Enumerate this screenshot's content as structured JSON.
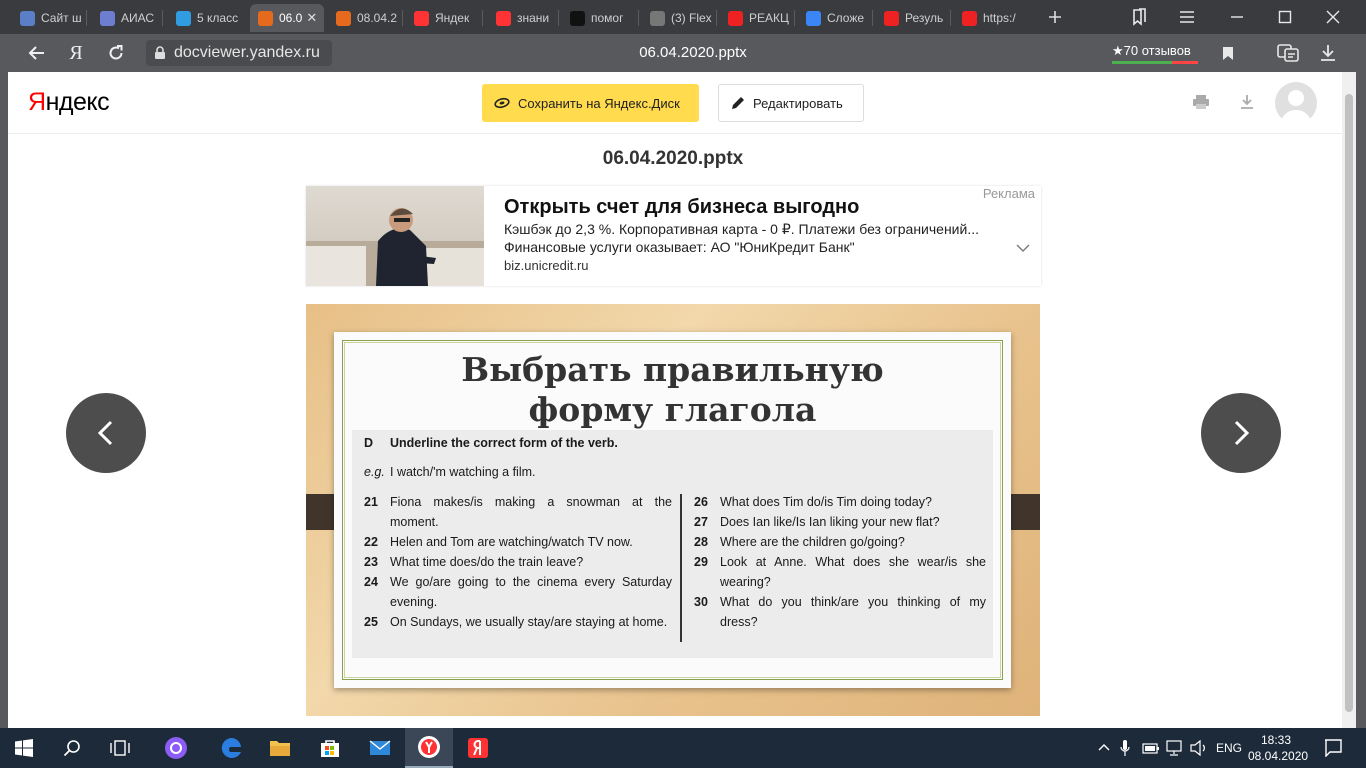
{
  "browser": {
    "tabs": [
      {
        "title": "Сайт ш",
        "icon": "site-icon",
        "color": "#5b7fc7"
      },
      {
        "title": "АИАС",
        "icon": "aias-icon",
        "color": "#6d7ed1"
      },
      {
        "title": "5 класс",
        "icon": "edu-icon",
        "color": "#2f9de0"
      },
      {
        "title": "06.0",
        "icon": "pptx-icon",
        "color": "#e56a1e",
        "active": true
      },
      {
        "title": "08.04.2",
        "icon": "pptx-icon",
        "color": "#e56a1e"
      },
      {
        "title": "Яндек",
        "icon": "yandex-icon",
        "color": "#f33"
      },
      {
        "title": "знани",
        "icon": "yandex-icon",
        "color": "#f33"
      },
      {
        "title": "помог",
        "icon": "znanija-icon",
        "color": "#111"
      },
      {
        "title": "(3) Flex",
        "icon": "flex-icon",
        "color": "#777"
      },
      {
        "title": "РЕАКЦ",
        "icon": "youtube-icon",
        "color": "#e22"
      },
      {
        "title": "Сложе",
        "icon": "doc-icon",
        "color": "#3b86f7"
      },
      {
        "title": "Резуль",
        "icon": "video-icon",
        "color": "#e22"
      },
      {
        "title": "https:/",
        "icon": "video-icon",
        "color": "#e22"
      }
    ],
    "url": "docviewer.yandex.ru",
    "doc_title": "06.04.2020.pptx",
    "reviews": "★70 отзывов"
  },
  "page": {
    "logo": "Яндекс",
    "logo_first": "Я",
    "logo_rest": "ндекс",
    "save_button": "Сохранить на Яндекс.Диск",
    "edit_button": "Редактировать",
    "title": "06.04.2020.pptx"
  },
  "ad": {
    "label": "Реклама",
    "headline": "Открыть счет для бизнеса выгодно",
    "line1": "Кэшбэк до 2,3 %. Корпоративная карта - 0 ₽. Платежи без ограничений...",
    "line2": "Финансовые услуги оказывает: АО \"ЮниКредит Банк\"",
    "url": "biz.unicredit.ru"
  },
  "slide": {
    "title_line1": "Выбрать правильную",
    "title_line2": "форму глагола",
    "exercise_letter": "D",
    "instruction": "Underline the correct form of the verb.",
    "example_label": "e.g.",
    "example": "I watch/'m watching a film.",
    "left_items": [
      {
        "n": "21",
        "text": "Fiona makes/is making a snowman at the moment."
      },
      {
        "n": "22",
        "text": "Helen and Tom are watching/watch TV now."
      },
      {
        "n": "23",
        "text": "What time does/do the train leave?"
      },
      {
        "n": "24",
        "text": "We go/are going to the cinema every Saturday evening."
      },
      {
        "n": "25",
        "text": "On Sundays, we usually stay/are staying at home."
      }
    ],
    "right_items": [
      {
        "n": "26",
        "text": "What does Tim do/is Tim doing today?"
      },
      {
        "n": "27",
        "text": "Does Ian like/Is Ian liking your new flat?"
      },
      {
        "n": "28",
        "text": "Where are the children go/going?"
      },
      {
        "n": "29",
        "text": "Look at Anne. What does she wear/is she wearing?"
      },
      {
        "n": "30",
        "text": "What do you think/are you thinking of my dress?"
      }
    ]
  },
  "taskbar": {
    "language": "ENG",
    "time": "18:33",
    "date": "08.04.2020"
  },
  "colors": {
    "save_yellow": "#ffdb4d",
    "browser_dark": "#3a3b3f",
    "taskbar": "#1d2a3a"
  }
}
